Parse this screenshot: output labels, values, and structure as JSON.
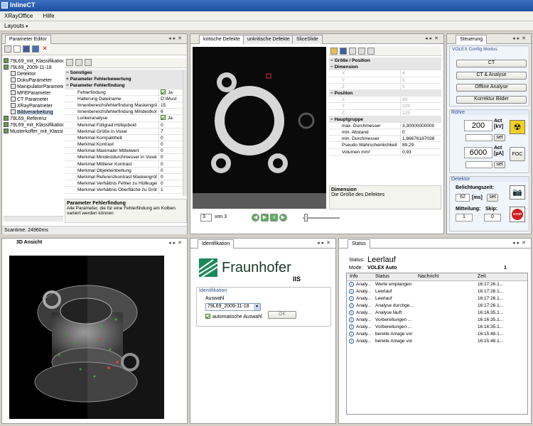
{
  "app": {
    "title": "InlineCT"
  },
  "menu": {
    "items": [
      "XRayOffice",
      "Hilfe"
    ]
  },
  "layouts": {
    "label": "Layouts"
  },
  "param_editor": {
    "tab": "Parameter Editor",
    "tree": [
      {
        "label": "79L69_mit_Klassifikation",
        "indent": 0
      },
      {
        "label": "79L69_2009-11-18",
        "indent": 0
      },
      {
        "label": "Detektor",
        "indent": 1
      },
      {
        "label": "DokuParameter",
        "indent": 1
      },
      {
        "label": "ManipulatorParameter",
        "indent": 1
      },
      {
        "label": "MFEParameter",
        "indent": 1
      },
      {
        "label": "CT Parameter",
        "indent": 1
      },
      {
        "label": "XRayParameter",
        "indent": 1
      },
      {
        "label": "Bildverarbeitung",
        "indent": 1
      },
      {
        "label": "79L69_Referenz",
        "indent": 0
      },
      {
        "label": "79L69_mit_Klassifikation",
        "indent": 0
      },
      {
        "label": "Musterkoffer_mit_Klassifik",
        "indent": 0
      }
    ],
    "grid": [
      {
        "cat": true,
        "label": "Sonstiges"
      },
      {
        "cat": true,
        "label": "Parameter Fehlerbewertung",
        "exp": "+"
      },
      {
        "cat": true,
        "label": "Parameter Fehlerfindung",
        "exp": "−"
      },
      {
        "label": "Fehlerfindung",
        "value": "Ja",
        "check": true
      },
      {
        "label": "Halterung Dateiname",
        "value": "D:\\Must"
      },
      {
        "label": "Innenbereichsfehlerfindung Maskengröß",
        "value": "15"
      },
      {
        "label": "Innenbereichsfehlerfindung Mindestkont",
        "value": "6"
      },
      {
        "label": "Lunkeranalyse",
        "value": "Ja",
        "check": true
      },
      {
        "label": "Merkmal Füllgrad Hüllquboid",
        "value": "0"
      },
      {
        "label": "Merkmal Größe in Voxel",
        "value": "7"
      },
      {
        "label": "Merkmal Kompaktheit",
        "value": "0"
      },
      {
        "label": "Merkmal Kontrast",
        "value": "0"
      },
      {
        "label": "Merkmal Maximaler Mittelwert",
        "value": "0"
      },
      {
        "label": "Merkmal Mindestdurchmesser in Voxel",
        "value": "0"
      },
      {
        "label": "Merkmal Mittlerer Kontrast",
        "value": "0"
      },
      {
        "label": "Merkmal Objekteinbettung",
        "value": "0"
      },
      {
        "label": "Merkmal Referenzkontrast Maskengröße",
        "value": "0"
      },
      {
        "label": "Merkmal Verhältnis Fehler zu Hüllkugel",
        "value": "0"
      },
      {
        "label": "Merkmal Verhältnis Oberfläche zu Größe",
        "value": "1"
      }
    ],
    "desc_title": "Parameter Fehlerfindung",
    "desc_text": "Alle Parameter, die für eine Fehlerfindung am Kolben variiert werden können",
    "status": "Scantime: 24960ms"
  },
  "defects": {
    "tabs": [
      "kritische Defekte",
      "unkritische Defekte",
      "SliceSlide"
    ],
    "page_value": "3",
    "page_of": "von 3",
    "grid": [
      {
        "cat": true,
        "label": "Größe / Position"
      },
      {
        "cat": true,
        "label": "Dimension",
        "exp": "−"
      },
      {
        "label": "X",
        "value": "4",
        "dim": true
      },
      {
        "label": "Y",
        "value": "5",
        "dim": true
      },
      {
        "label": "Z",
        "value": "5",
        "dim": true
      },
      {
        "cat": true,
        "label": "Position",
        "exp": "−"
      },
      {
        "label": "X",
        "value": "69",
        "dim": true
      },
      {
        "label": "Y",
        "value": "229",
        "dim": true
      },
      {
        "label": "Z",
        "value": "225",
        "dim": true
      },
      {
        "cat": true,
        "label": "Hauptgruppe"
      },
      {
        "label": "max. Durchmesser",
        "value": "3,30000000000"
      },
      {
        "label": "min. Abstand",
        "value": "0"
      },
      {
        "label": "min. Durchmesser",
        "value": "1,86676187038"
      },
      {
        "label": "Pseudo Wahrscheinlichkeit in %",
        "value": "89,29"
      },
      {
        "label": "Volumen mm³",
        "value": "0,93"
      }
    ],
    "desc_title": "Dimension",
    "desc_text": "Die Größe des Defektes"
  },
  "steuerung": {
    "tab": "Steuerung",
    "mode": "VOLEX Config Modus",
    "buttons": [
      "CT",
      "CT & Analyse",
      "Offline Analyse",
      "Korrektur Bilder"
    ],
    "roehre": "Röhre",
    "kv_value": "200",
    "kv_label": "Act [kV]",
    "ua_value": "6000",
    "ua_label": "Act [µA]",
    "set": "set",
    "foc": "FOC",
    "detektor": "Detektor",
    "belicht": "Belichtungszeit:",
    "belicht_val": "62",
    "ms": "[ms]",
    "mitteln": "Mitteilung:",
    "mitteln_val": "1",
    "skip": "Skip:",
    "skip_val": "0",
    "stop": "STOP"
  },
  "ansicht": {
    "tab": "3D Ansicht"
  },
  "ident": {
    "tab": "Identifikation",
    "logo": "Fraunhofer",
    "sub": "IIS",
    "group": "Identifikation",
    "auswahl": "Auswahl",
    "select": "79L69_2009-11-18",
    "auto": "automatische Auswahl",
    "ok": "OK"
  },
  "status": {
    "tab": "Status",
    "status_label": "Status:",
    "status_value": "Leerlauf",
    "mode_label": "Mode:",
    "mode_value": "VOLEX Auto",
    "mode_num": "1",
    "columns": [
      "Info",
      "Status",
      "Nachricht",
      "Zeit"
    ],
    "rows": [
      {
        "info": "Analy...",
        "status": "Werte emplangen",
        "zeit": "16:17:26.1..."
      },
      {
        "info": "Analy...",
        "status": "Leerlauf",
        "zeit": "16:17:26.1..."
      },
      {
        "info": "Analy...",
        "status": "Leerlauf",
        "zeit": "16:17:26.1..."
      },
      {
        "info": "Analy...",
        "status": "Analyse durchge...",
        "zeit": "16:17:26.1..."
      },
      {
        "info": "Analy...",
        "status": "Analyse läuft",
        "zeit": "16:16:35.1..."
      },
      {
        "info": "Analy...",
        "status": "Vorbereitungen ...",
        "zeit": "16:16:35.1..."
      },
      {
        "info": "Analy...",
        "status": "Vorbereitungen ...",
        "zeit": "16:16:35.1..."
      },
      {
        "info": "Analy...",
        "status": "bereite Anlage vor",
        "zeit": "16:15:48.1..."
      },
      {
        "info": "Analy...",
        "status": "bereite Anlage vor",
        "zeit": "16:15:48.1..."
      }
    ]
  },
  "colors": {
    "title": "#1d4f9f",
    "accent": "#304f8f",
    "logo_green": "#1a8a5a",
    "stop": "#d02020"
  }
}
